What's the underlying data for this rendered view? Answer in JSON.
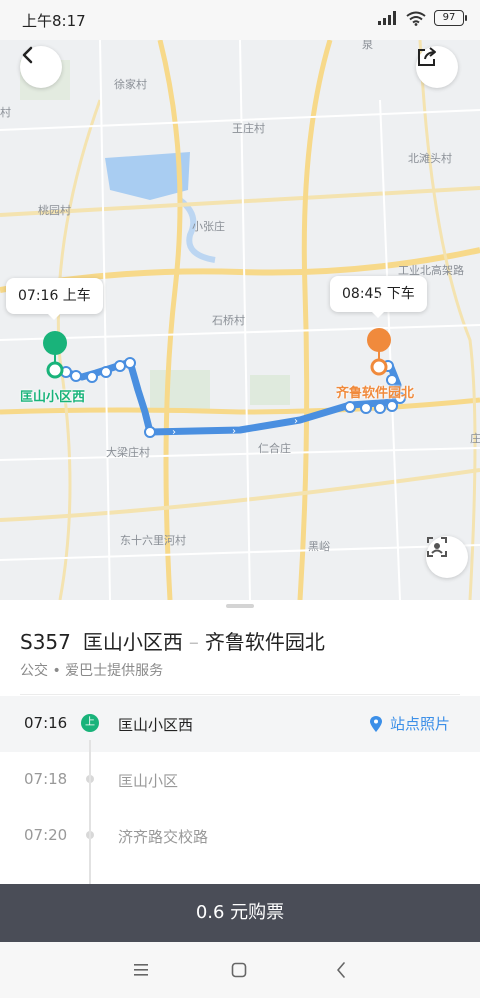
{
  "status_bar": {
    "time": "上午8:17",
    "battery": "97"
  },
  "map": {
    "place_labels": {
      "xujia": "徐家村",
      "wangzhuang": "王庄村",
      "beihu": "北滩头村",
      "taoyuan": "桃园村",
      "xiaozhang": "小张庄",
      "gonglu": "工业北高架路",
      "shiqiao": "石桥村",
      "dailiang": "大梁庄村",
      "renhe": "仁合庄",
      "dongshiliu": "东十六里河村",
      "heiyan": "黑峪",
      "zhuang": "庄",
      "quan": "泉",
      "cun": "村"
    },
    "board_bubble": "07:16 上车",
    "alight_bubble": "08:45 下车",
    "start_marker": "上",
    "end_marker": "下",
    "start_stop": "匡山小区西",
    "end_stop": "齐鲁软件园北",
    "colors": {
      "route": "#4a8fe0",
      "start": "#19b37a",
      "end": "#f08a3c"
    }
  },
  "route": {
    "number": "S357",
    "from": "匡山小区西",
    "to": "齐鲁软件园北",
    "separator": "–",
    "subtitle": "公交 • 爱巴士提供服务"
  },
  "stops": [
    {
      "time": "07:16",
      "name": "匡山小区西",
      "badge": "上",
      "link": "站点照片"
    },
    {
      "time": "07:18",
      "name": "匡山小区"
    },
    {
      "time": "07:20",
      "name": "济齐路交校路"
    }
  ],
  "buy_button": "0.6 元购票",
  "icons": [
    "back-icon",
    "share-icon",
    "locate-icon",
    "location-pin-icon",
    "menu-icon",
    "home-icon",
    "nav-back-icon"
  ]
}
